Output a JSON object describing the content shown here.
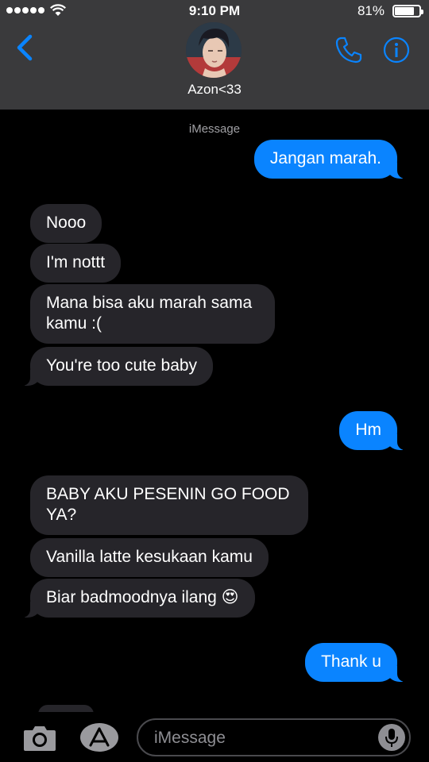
{
  "status_bar": {
    "time": "9:10 PM",
    "battery_percent": "81%",
    "battery_level": 0.81,
    "signal_bars": 5
  },
  "header": {
    "back_icon": "chevron-left-icon",
    "contact_name": "Azon<33",
    "call_icon": "phone-icon",
    "info_icon": "info-icon"
  },
  "conversation": {
    "service_label": "iMessage",
    "messages": [
      {
        "direction": "outgoing",
        "text": "Jangan marah."
      },
      {
        "direction": "incoming",
        "text": "Nooo"
      },
      {
        "direction": "incoming",
        "text": "I'm nottt"
      },
      {
        "direction": "incoming",
        "text": "Mana bisa aku marah sama kamu :("
      },
      {
        "direction": "incoming",
        "text": "You're too cute baby"
      },
      {
        "direction": "outgoing",
        "text": "Hm"
      },
      {
        "direction": "incoming",
        "text": "BABY AKU PESENIN GO FOOD YA?"
      },
      {
        "direction": "incoming",
        "text": "Vanilla latte kesukaan kamu"
      },
      {
        "direction": "incoming",
        "text": "Biar badmoodnya ilang 😍"
      },
      {
        "direction": "outgoing",
        "text": "Thank u"
      }
    ]
  },
  "input_bar": {
    "camera_icon": "camera-icon",
    "apps_icon": "app-store-icon",
    "placeholder": "iMessage",
    "mic_icon": "microphone-icon"
  },
  "colors": {
    "header_bg": "#3a3a3c",
    "outgoing_bubble": "#0a84ff",
    "incoming_bubble": "#26252a",
    "accent": "#0a84ff"
  }
}
